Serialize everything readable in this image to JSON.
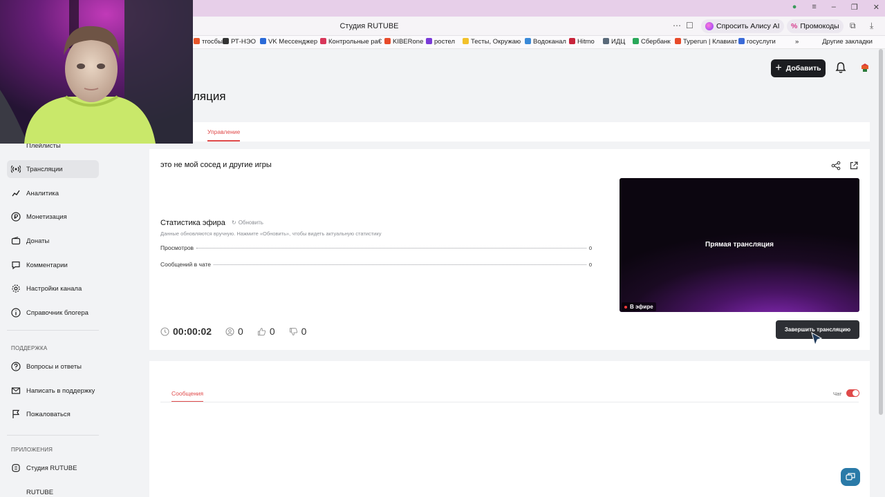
{
  "browser": {
    "window_title": "",
    "tab_title": "Студия RUTUBE",
    "alice_label": "Спросить Алису AI",
    "promo_label": "Промокоды",
    "bookmarks": [
      "тгосбыт",
      "РТ-НЭО",
      "VK Мессенджер",
      "Контрольные ра€",
      "KIBERone",
      "ростел",
      "Тесты, Окружаю",
      "Водоканал",
      "Hitmo",
      "ИДЦ",
      "Сбербанк",
      "Typerun | Клавиат",
      "госуслуги"
    ],
    "other_bookmarks": "Другие закладки"
  },
  "header": {
    "add_label": "Добавить",
    "page_title": "ляция"
  },
  "sidebar": {
    "items": [
      {
        "label": "Плейлисты",
        "icon": "playlist-icon"
      },
      {
        "label": "Трансляции",
        "icon": "broadcast-icon",
        "active": true
      },
      {
        "label": "Аналитика",
        "icon": "analytics-icon"
      },
      {
        "label": "Монетизация",
        "icon": "ruble-icon"
      },
      {
        "label": "Донаты",
        "icon": "wallet-icon"
      },
      {
        "label": "Комментарии",
        "icon": "comment-icon"
      },
      {
        "label": "Настройки канала",
        "icon": "gear-icon"
      },
      {
        "label": "Справочник блогера",
        "icon": "info-icon"
      }
    ],
    "support_section": "ПОДДЕРЖКА",
    "support_items": [
      {
        "label": "Вопросы и ответы",
        "icon": "question-icon"
      },
      {
        "label": "Написать в поддержку",
        "icon": "mail-icon"
      },
      {
        "label": "Пожаловаться",
        "icon": "flag-icon"
      }
    ],
    "apps_section": "ПРИЛОЖЕНИЯ",
    "app_items": [
      {
        "label": "Студия RUTUBE",
        "icon": "studio-icon"
      },
      {
        "label": "RUTUBE",
        "icon": "rutube-icon"
      }
    ]
  },
  "tabs": {
    "manage": "Управление"
  },
  "stream": {
    "title": "это не мой сосед и другие игры",
    "stats_title": "Статистика эфира",
    "refresh_label": "Обновить",
    "stats_hint": "Данные обновляются вручную. Нажмите «Обновить», чтобы видеть актуальную статистику",
    "views_label": "Просмотров",
    "views_value": "0",
    "chat_messages_label": "Сообщений в чате",
    "chat_messages_value": "0",
    "duration": "00:00:02",
    "viewers": "0",
    "likes": "0",
    "dislikes": "0",
    "preview_label": "Прямая трансляция",
    "live_badge": "В эфире",
    "end_button": "Завершить трансляцию"
  },
  "messages": {
    "tab": "Сообщения",
    "chat_toggle_label": "Чат",
    "chat_enabled": true
  },
  "colors": {
    "accent": "#e04a4a",
    "dark_button": "#1c1d21",
    "preview_purple": "#8a2bbd"
  }
}
